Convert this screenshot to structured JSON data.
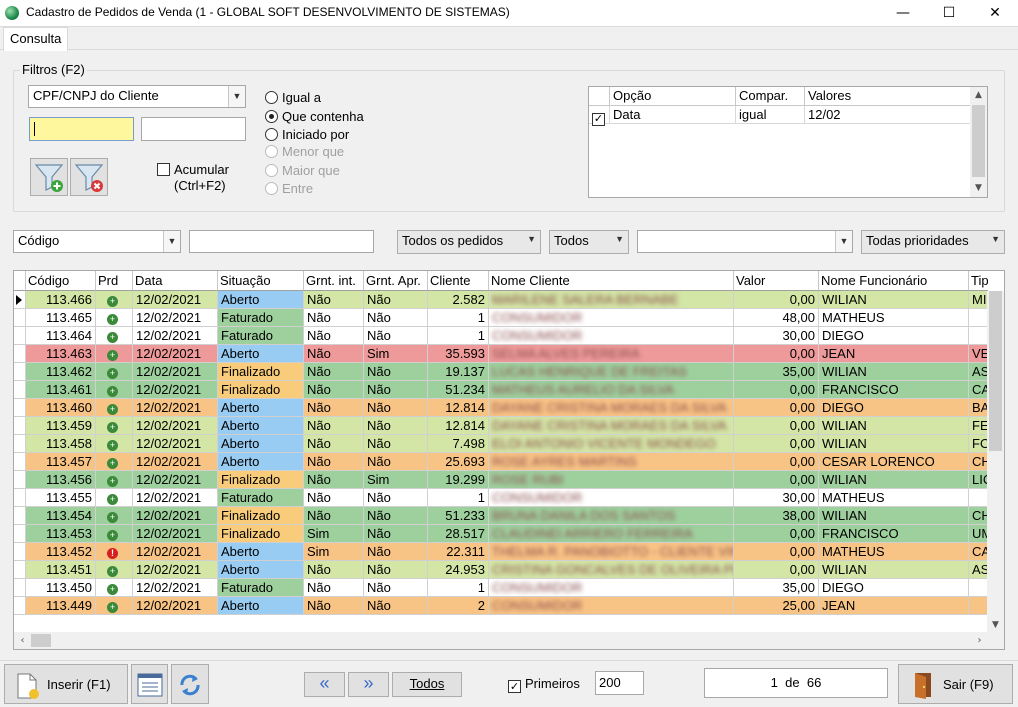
{
  "window": {
    "title": "Cadastro de Pedidos de Venda (1 - GLOBAL SOFT DESENVOLVIMENTO DE SISTEMAS)",
    "min": "—",
    "max": "☐",
    "close": "✕"
  },
  "tabs": [
    {
      "label": "Consulta"
    }
  ],
  "filters": {
    "legend": "Filtros (F2)",
    "field_select": "CPF/CNPJ do Cliente",
    "value1": "",
    "value2": "",
    "radios": [
      {
        "label": "Igual a",
        "selected": false,
        "enabled": true
      },
      {
        "label": "Que contenha",
        "selected": true,
        "enabled": true
      },
      {
        "label": "Iniciado por",
        "selected": false,
        "enabled": true
      },
      {
        "label": "Menor que",
        "selected": false,
        "enabled": false
      },
      {
        "label": "Maior que",
        "selected": false,
        "enabled": false
      },
      {
        "label": "Entre",
        "selected": false,
        "enabled": false
      }
    ],
    "accumulate_label1": "Acumular",
    "accumulate_label2": "(Ctrl+F2)",
    "criteria_headers": [
      "Opção",
      "Compar.",
      "Valores"
    ],
    "criteria": [
      {
        "checked": "✓",
        "option": "Data",
        "compare": "igual",
        "values": "12/02"
      }
    ]
  },
  "search": {
    "field": "Código",
    "value": "",
    "orders": "Todos os pedidos",
    "status": "Todos",
    "extra": "",
    "priority": "Todas prioridades"
  },
  "grid": {
    "headers": [
      "Código",
      "Prd",
      "Data",
      "Situação",
      "Grnt. int.",
      "Grnt. Apr.",
      "Cliente",
      "Nome Cliente",
      "Valor",
      "Nome Funcionário",
      "Tip"
    ],
    "rows": [
      {
        "codigo": "113.466",
        "prd": "ok",
        "data": "12/02/2021",
        "situacao": "Aberto",
        "gint": "Não",
        "gapr": "Não",
        "cliente": "2.582",
        "nome": "MARILENE SALERA BERNABE",
        "valor": "0,00",
        "func": "WILIAN",
        "tip": "MI",
        "bg": "#d3e6a6"
      },
      {
        "codigo": "113.465",
        "prd": "ok",
        "data": "12/02/2021",
        "situacao": "Faturado",
        "gint": "Não",
        "gapr": "Não",
        "cliente": "1",
        "nome": "CONSUMIDOR",
        "valor": "48,00",
        "func": "MATHEUS",
        "tip": "",
        "bg": "#ffffff"
      },
      {
        "codigo": "113.464",
        "prd": "ok",
        "data": "12/02/2021",
        "situacao": "Faturado",
        "gint": "Não",
        "gapr": "Não",
        "cliente": "1",
        "nome": "CONSUMIDOR",
        "valor": "30,00",
        "func": "DIEGO",
        "tip": "",
        "bg": "#ffffff"
      },
      {
        "codigo": "113.463",
        "prd": "ok",
        "data": "12/02/2021",
        "situacao": "Aberto",
        "gint": "Não",
        "gapr": "Sim",
        "cliente": "35.593",
        "nome": "SELMA ALVES PEREIRA",
        "valor": "0,00",
        "func": "JEAN",
        "tip": "VE",
        "bg": "#ee9a9a"
      },
      {
        "codigo": "113.462",
        "prd": "ok",
        "data": "12/02/2021",
        "situacao": "Finalizado",
        "gint": "Não",
        "gapr": "Não",
        "cliente": "19.137",
        "nome": "LUCAS HENRIQUE DE FREITAS",
        "valor": "35,00",
        "func": "WILIAN",
        "tip": "AS",
        "bg": "#9ed09e"
      },
      {
        "codigo": "113.461",
        "prd": "ok",
        "data": "12/02/2021",
        "situacao": "Finalizado",
        "gint": "Não",
        "gapr": "Não",
        "cliente": "51.234",
        "nome": "MATHEUS AURELIO DA SILVA",
        "valor": "0,00",
        "func": "FRANCISCO",
        "tip": "CA",
        "bg": "#9ed09e"
      },
      {
        "codigo": "113.460",
        "prd": "ok",
        "data": "12/02/2021",
        "situacao": "Aberto",
        "gint": "Não",
        "gapr": "Não",
        "cliente": "12.814",
        "nome": "DAYANE CRISTINA MORAES DA SILVA",
        "valor": "0,00",
        "func": "DIEGO",
        "tip": "BA",
        "bg": "#f8c486"
      },
      {
        "codigo": "113.459",
        "prd": "ok",
        "data": "12/02/2021",
        "situacao": "Aberto",
        "gint": "Não",
        "gapr": "Não",
        "cliente": "12.814",
        "nome": "DAYANE CRISTINA MORAES DA SILVA",
        "valor": "0,00",
        "func": "WILIAN",
        "tip": "FE",
        "bg": "#d3e6a6"
      },
      {
        "codigo": "113.458",
        "prd": "ok",
        "data": "12/02/2021",
        "situacao": "Aberto",
        "gint": "Não",
        "gapr": "Não",
        "cliente": "7.498",
        "nome": "ELOI ANTONIO VICENTE MONDEGO",
        "valor": "0,00",
        "func": "WILIAN",
        "tip": "FO",
        "bg": "#d3e6a6"
      },
      {
        "codigo": "113.457",
        "prd": "ok",
        "data": "12/02/2021",
        "situacao": "Aberto",
        "gint": "Não",
        "gapr": "Não",
        "cliente": "25.693",
        "nome": "ROSE AYRES MARTINS",
        "valor": "0,00",
        "func": "CESAR LORENCO",
        "tip": "CH",
        "bg": "#f8c486"
      },
      {
        "codigo": "113.456",
        "prd": "ok",
        "data": "12/02/2021",
        "situacao": "Finalizado",
        "gint": "Não",
        "gapr": "Sim",
        "cliente": "19.299",
        "nome": "ROSE RUBI",
        "valor": "0,00",
        "func": "WILIAN",
        "tip": "LIC",
        "bg": "#9ed09e"
      },
      {
        "codigo": "113.455",
        "prd": "ok",
        "data": "12/02/2021",
        "situacao": "Faturado",
        "gint": "Não",
        "gapr": "Não",
        "cliente": "1",
        "nome": "CONSUMIDOR",
        "valor": "30,00",
        "func": "MATHEUS",
        "tip": "",
        "bg": "#ffffff"
      },
      {
        "codigo": "113.454",
        "prd": "ok",
        "data": "12/02/2021",
        "situacao": "Finalizado",
        "gint": "Não",
        "gapr": "Não",
        "cliente": "51.233",
        "nome": "BRUNA DANILA DOS SANTOS",
        "valor": "38,00",
        "func": "WILIAN",
        "tip": "CH",
        "bg": "#9ed09e"
      },
      {
        "codigo": "113.453",
        "prd": "ok",
        "data": "12/02/2021",
        "situacao": "Finalizado",
        "gint": "Sim",
        "gapr": "Não",
        "cliente": "28.517",
        "nome": "CLAUDINEI ARRIERO FERREIRA",
        "valor": "0,00",
        "func": "FRANCISCO",
        "tip": "UM",
        "bg": "#9ed09e"
      },
      {
        "codigo": "113.452",
        "prd": "alert",
        "data": "12/02/2021",
        "situacao": "Aberto",
        "gint": "Sim",
        "gapr": "Não",
        "cliente": "22.311",
        "nome": "THELMA R. PANOBIOTTO - CLIENTE VIP",
        "valor": "0,00",
        "func": "MATHEUS",
        "tip": "CA",
        "bg": "#f8c486"
      },
      {
        "codigo": "113.451",
        "prd": "ok",
        "data": "12/02/2021",
        "situacao": "Aberto",
        "gint": "Não",
        "gapr": "Não",
        "cliente": "24.953",
        "nome": "CRISTINA GONCALVES DE OLIVEIRA PE",
        "valor": "0,00",
        "func": "WILIAN",
        "tip": "AS",
        "bg": "#d3e6a6"
      },
      {
        "codigo": "113.450",
        "prd": "ok",
        "data": "12/02/2021",
        "situacao": "Faturado",
        "gint": "Não",
        "gapr": "Não",
        "cliente": "1",
        "nome": "CONSUMIDOR",
        "valor": "35,00",
        "func": "DIEGO",
        "tip": "",
        "bg": "#ffffff"
      },
      {
        "codigo": "113.449",
        "prd": "ok",
        "data": "12/02/2021",
        "situacao": "Aberto",
        "gint": "Não",
        "gapr": "Não",
        "cliente": "2",
        "nome": "CONSUMIDOR",
        "valor": "25,00",
        "func": "JEAN",
        "tip": "",
        "bg": "#f8c486"
      }
    ]
  },
  "situacao_colors": {
    "Aberto": "#99ccf2",
    "Faturado": "#9ed09e",
    "Finalizado": "#f8cc7a"
  },
  "bottom": {
    "insert_label": "Inserir (F1)",
    "all_label": "Todos",
    "first_label": "Primeiros",
    "first_checked": "✓",
    "first_value": "200",
    "page_current": "1",
    "page_sep": "de",
    "page_total": "66",
    "exit_label": "Sair (F9)"
  }
}
